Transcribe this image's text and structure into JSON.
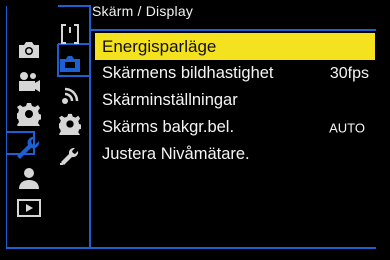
{
  "header": {
    "title": "Skärm / Display"
  },
  "icons": {
    "left_column": [
      "camera-icon",
      "video-camera-icon",
      "gear-icon",
      "wrench-icon",
      "person-icon",
      "play-icon"
    ],
    "sub_column": [
      "bracket-page-icon",
      "lcd-display-icon",
      "wifi-page-icon",
      "gear-page-icon",
      "wrench-page-icon"
    ]
  },
  "menu": {
    "items": [
      {
        "label": "Energisparläge",
        "value": "",
        "selected": true
      },
      {
        "label": "Skärmens bildhastighet",
        "value": "30fps",
        "selected": false
      },
      {
        "label": "Skärminställningar",
        "value": "",
        "selected": false
      },
      {
        "label": "Skärms bakgr.bel.",
        "value": "AUTO",
        "selected": false
      },
      {
        "label": "Justera Nivåmätare.",
        "value": "",
        "selected": false
      }
    ]
  },
  "colors": {
    "accent_blue": "#1e5fd2",
    "highlight_yellow": "#f4e21f",
    "icon_gray": "#d6d6d6"
  }
}
